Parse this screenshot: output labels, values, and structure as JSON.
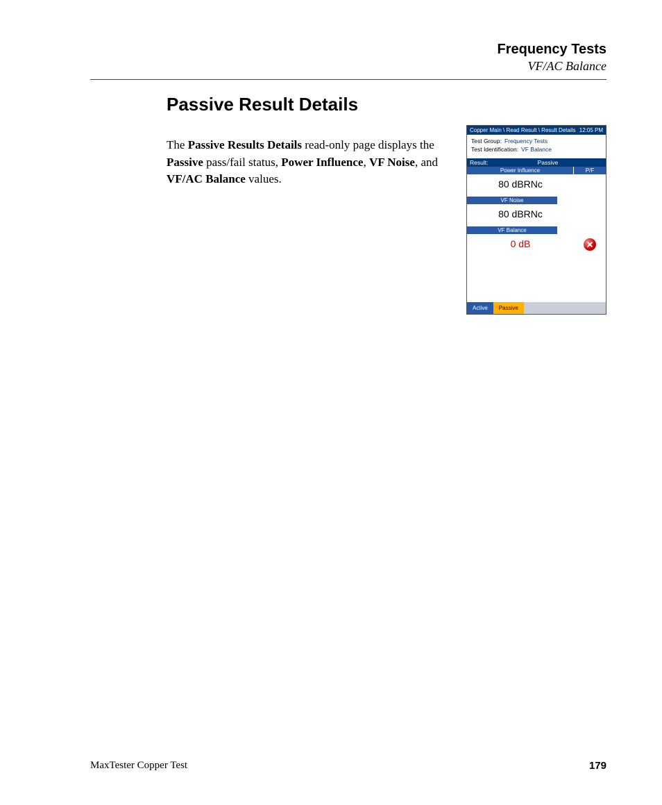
{
  "header": {
    "title": "Frequency Tests",
    "subtitle": "VF/AC Balance"
  },
  "section": {
    "title": "Passive Result Details",
    "text_parts": {
      "t1": "The ",
      "b1": "Passive Results Details",
      "t2": " read-only page displays the ",
      "b2": "Passive",
      "t3": " pass/fail status, ",
      "b3": "Power Influence",
      "t4": ", ",
      "b4": "VF Noise",
      "t5": ", and ",
      "b5": "VF/AC Balance",
      "t6": " values."
    }
  },
  "device": {
    "breadcrumb": "Copper Main \\ Read Result \\ Result Details",
    "time": "12:05 PM",
    "meta": {
      "group_label": "Test Group:",
      "group_value": "Frequency Tests",
      "id_label": "Test Identification:",
      "id_value": "VF Balance"
    },
    "result_bar": {
      "label": "Result:",
      "status": "Passive"
    },
    "columns": {
      "power_influence": "Power Influence",
      "pf": "P/F"
    },
    "rows": {
      "power_influence_value": "80 dBRNc",
      "vf_noise_header": "VF Noise",
      "vf_noise_value": "80 dBRNc",
      "vf_balance_header": "VF Balance",
      "vf_balance_value": "0 dB"
    },
    "tabs": {
      "active_tab_other": "Active",
      "active_tab_current": "Passive"
    }
  },
  "footer": {
    "product": "MaxTester Copper Test",
    "page": "179"
  }
}
